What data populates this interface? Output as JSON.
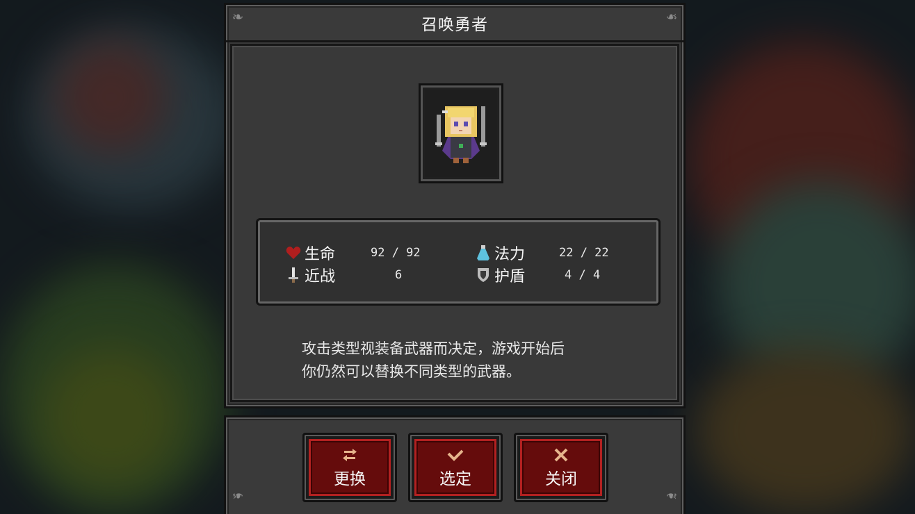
{
  "dialog": {
    "title": "召唤勇者"
  },
  "hero": {
    "portrait": "blonde-knight-sprite"
  },
  "stats": {
    "hp": {
      "label": "生命",
      "value": "92 / 92",
      "icon": "heart-icon",
      "color": "#b01e1e"
    },
    "mp": {
      "label": "法力",
      "value": "22 / 22",
      "icon": "potion-icon",
      "color": "#5ec1de"
    },
    "melee": {
      "label": "近战",
      "value": "6",
      "icon": "sword-icon",
      "color": "#e3e3e3"
    },
    "shield": {
      "label": "护盾",
      "value": "4 / 4",
      "icon": "shield-icon",
      "color": "#bdbdbd"
    }
  },
  "description": {
    "line1": "攻击类型视装备武器而决定，游戏开始后",
    "line2": "你仍然可以替换不同类型的武器。"
  },
  "buttons": {
    "swap": {
      "label": "更换",
      "icon": "swap-icon"
    },
    "select": {
      "label": "选定",
      "icon": "check-icon"
    },
    "close": {
      "label": "关闭",
      "icon": "close-icon"
    }
  },
  "colors": {
    "panel": "#3a3a3a",
    "button_fill": "#650c0c",
    "button_border": "#b32121",
    "icon_accent": "#e6b48c"
  }
}
